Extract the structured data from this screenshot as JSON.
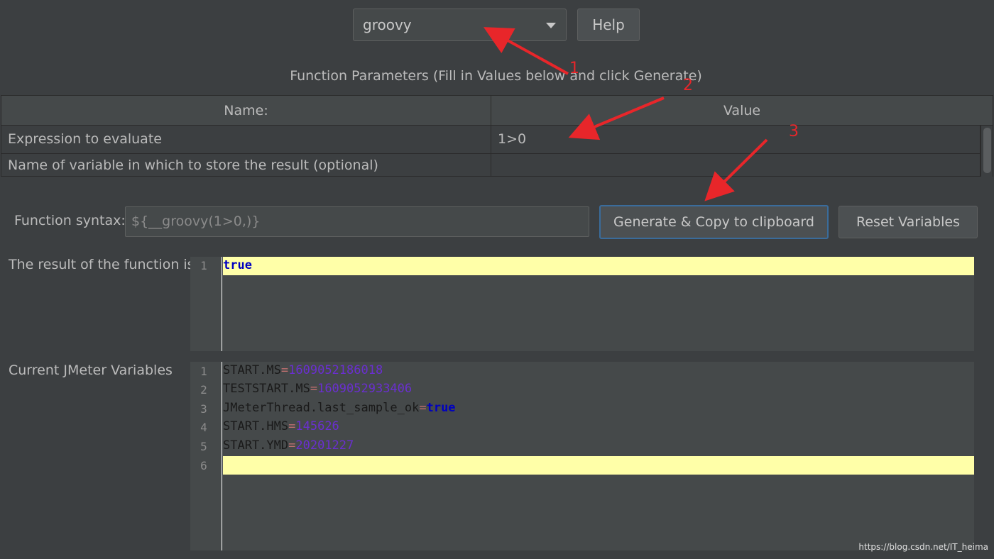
{
  "top": {
    "function_select": "groovy",
    "help_label": "Help"
  },
  "params_title": "Function Parameters (Fill in Values below and click Generate)",
  "table": {
    "headers": [
      "Name:",
      "Value"
    ],
    "rows": [
      {
        "name": "Expression to evaluate",
        "value": "1>0"
      },
      {
        "name": "Name of variable in which to store the result (optional)",
        "value": ""
      }
    ]
  },
  "syntax": {
    "label": "Function syntax:",
    "value": "${__groovy(1>0,)}",
    "generate_label": "Generate & Copy to clipboard",
    "reset_label": "Reset Variables"
  },
  "result": {
    "label": "The result of the function is",
    "line_number": "1",
    "value": "true"
  },
  "variables": {
    "label": "Current JMeter Variables",
    "lines": [
      {
        "num": "1",
        "key": "START.MS",
        "value": "1609052186018"
      },
      {
        "num": "2",
        "key": "TESTSTART.MS",
        "value": "1609052933406"
      },
      {
        "num": "3",
        "key": "JMeterThread.last_sample_ok",
        "value": "true"
      },
      {
        "num": "4",
        "key": "START.HMS",
        "value": "145626"
      },
      {
        "num": "5",
        "key": "START.YMD",
        "value": "20201227"
      },
      {
        "num": "6",
        "key": "",
        "value": ""
      }
    ]
  },
  "annotations": [
    "1",
    "2",
    "3"
  ],
  "watermark": "https://blog.csdn.net/IT_heima",
  "colors": {
    "annotation": "#e8262a",
    "highlight": "#ffffa8",
    "focus_border": "#3a6c9b"
  }
}
